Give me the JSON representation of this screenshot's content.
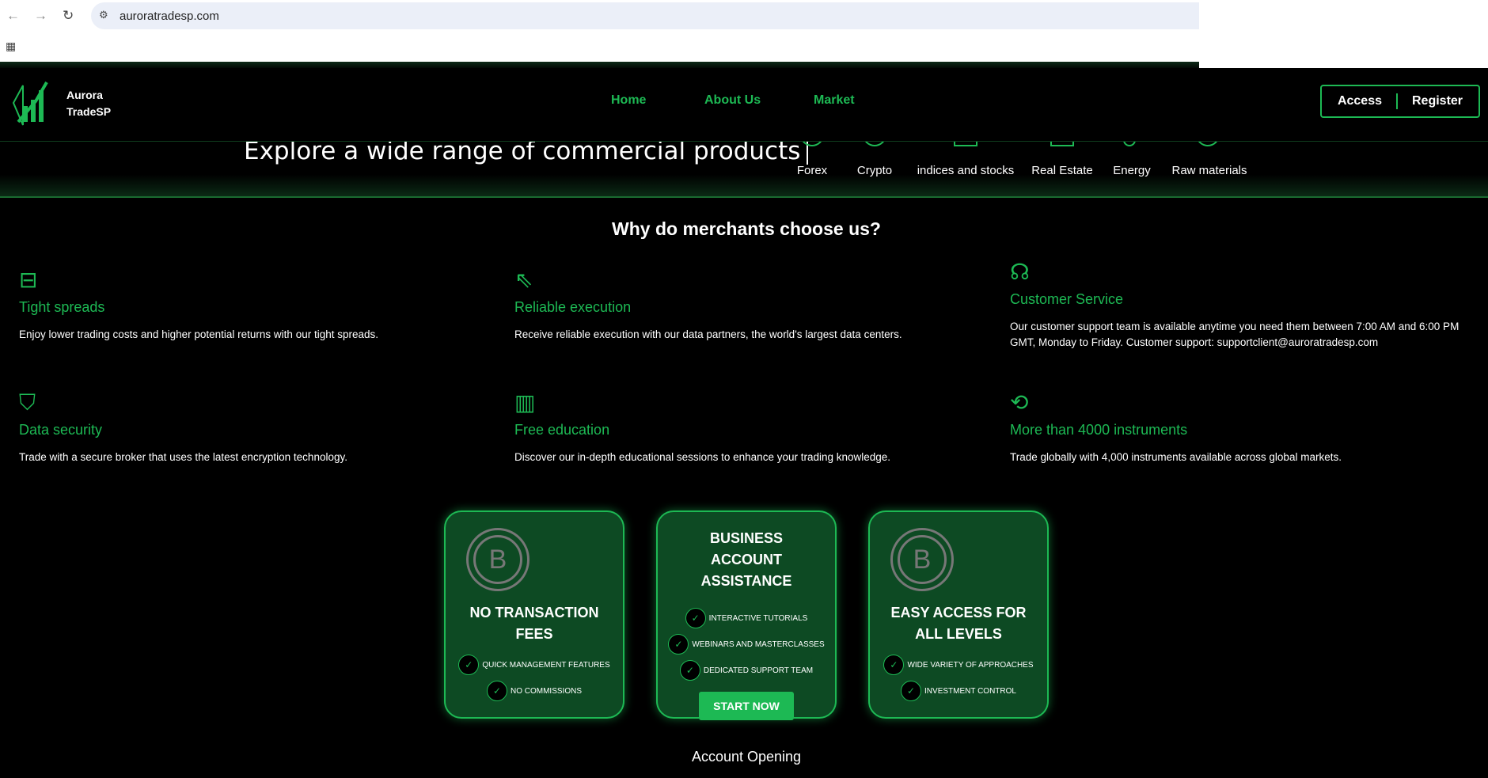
{
  "browser": {
    "url": "auroratradesp.com"
  },
  "header": {
    "brand_line1": "Aurora",
    "brand_line2": "TradeSP",
    "nav": [
      "Home",
      "About Us",
      "Market"
    ],
    "access": "Access",
    "register": "Register"
  },
  "hero": {
    "text": "Explore a wide range of commercial products",
    "categories": [
      "Forex",
      "Crypto",
      "indices and stocks",
      "Real Estate",
      "Energy",
      "Raw materials"
    ]
  },
  "why": {
    "title": "Why do merchants choose us?",
    "features": [
      {
        "title": "Tight spreads",
        "desc": "Enjoy lower trading costs and higher potential returns with our tight spreads.",
        "icon": "spread-icon"
      },
      {
        "title": "Reliable execution",
        "desc": "Receive reliable execution with our data partners, the world's largest data centers.",
        "icon": "cursor-click-icon"
      },
      {
        "title": "Customer Service",
        "desc": "Our customer support team is available anytime you need them between 7:00 AM and 6:00 PM GMT, Monday to Friday. Customer support: supportclient@auroratradesp.com",
        "icon": "headset-icon"
      },
      {
        "title": "Data security",
        "desc": "Trade with a secure broker that uses the latest encryption technology.",
        "icon": "shield-check-icon"
      },
      {
        "title": "Free education",
        "desc": "Discover our in-depth educational sessions to enhance your trading knowledge.",
        "icon": "books-icon"
      },
      {
        "title": "More than 4000 instruments",
        "desc": "Trade globally with 4,000 instruments available across global markets.",
        "icon": "refresh-icon"
      }
    ]
  },
  "cards": [
    {
      "title": "NO TRANSACTION FEES",
      "items": [
        "QUICK MANAGEMENT FEATURES",
        "NO COMMISSIONS"
      ]
    },
    {
      "title": "BUSINESS ACCOUNT ASSISTANCE",
      "items": [
        "INTERACTIVE TUTORIALS",
        "WEBINARS AND MASTERCLASSES",
        "DEDICATED SUPPORT TEAM"
      ],
      "button": "START NOW"
    },
    {
      "title": "EASY ACCESS FOR ALL LEVELS",
      "items": [
        "WIDE VARIETY OF APPROACHES",
        "INVESTMENT CONTROL"
      ]
    }
  ],
  "footer": {
    "section": "Account Opening"
  },
  "colors": {
    "accent": "#1db954",
    "card": "#0d4a23"
  }
}
